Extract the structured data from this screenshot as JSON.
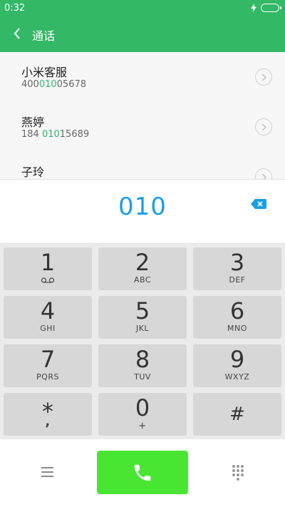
{
  "status": {
    "time": "0:32"
  },
  "header": {
    "title": "通话"
  },
  "contacts": [
    {
      "name": "小米客服",
      "num_pre": "400",
      "num_hl": "010",
      "num_post": "05678"
    },
    {
      "name": "燕婷",
      "num_pre": "184 ",
      "num_hl": "010",
      "num_post": "15689"
    },
    {
      "name": "子玲",
      "num_pre": "",
      "num_hl": "",
      "num_post": ""
    }
  ],
  "display": {
    "digits": "010"
  },
  "keys": [
    {
      "main": "1",
      "sub": "voicemail"
    },
    {
      "main": "2",
      "sub": "ABC"
    },
    {
      "main": "3",
      "sub": "DEF"
    },
    {
      "main": "4",
      "sub": "GHI"
    },
    {
      "main": "5",
      "sub": "JKL"
    },
    {
      "main": "6",
      "sub": "MNO"
    },
    {
      "main": "7",
      "sub": "PQRS"
    },
    {
      "main": "8",
      "sub": "TUV"
    },
    {
      "main": "9",
      "sub": "WXYZ"
    },
    {
      "main": "*",
      "sub": ","
    },
    {
      "main": "0",
      "sub": "+"
    },
    {
      "main": "#",
      "sub": ""
    }
  ],
  "colors": {
    "header": "#33b866",
    "digits": "#1a9fe3",
    "highlight": "#2eb66f",
    "call": "#48e632"
  }
}
